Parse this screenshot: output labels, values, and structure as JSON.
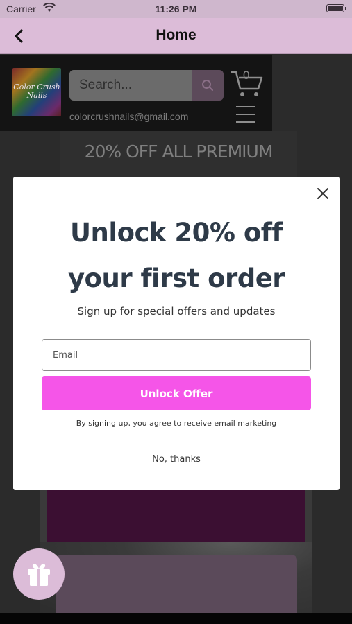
{
  "status_bar": {
    "carrier": "Carrier",
    "time": "11:26 PM"
  },
  "nav": {
    "title": "Home"
  },
  "site": {
    "logo_text": "Color Crush Nails",
    "search_placeholder": "Search...",
    "cart_count": "0",
    "email": "colorcrushnails@gmail.com",
    "promo_banner": "20% OFF ALL PREMIUM"
  },
  "modal": {
    "title_line1": "Unlock 20% off",
    "title_line2": "your first order",
    "subtitle": "Sign up for special offers and updates",
    "email_placeholder": "Email",
    "email_value": "",
    "cta_label": "Unlock Offer",
    "disclaimer": "By signing up, you agree to receive email marketing",
    "dismiss_label": "No, thanks"
  },
  "colors": {
    "nav_bg": "#dcbcd8",
    "cta_bg": "#f555e8",
    "title_color": "#2e3a48"
  },
  "icons": {
    "back": "chevron-left-icon",
    "close": "close-icon",
    "search": "search-icon",
    "cart": "cart-icon",
    "menu": "hamburger-menu-icon",
    "gift": "gift-icon"
  }
}
